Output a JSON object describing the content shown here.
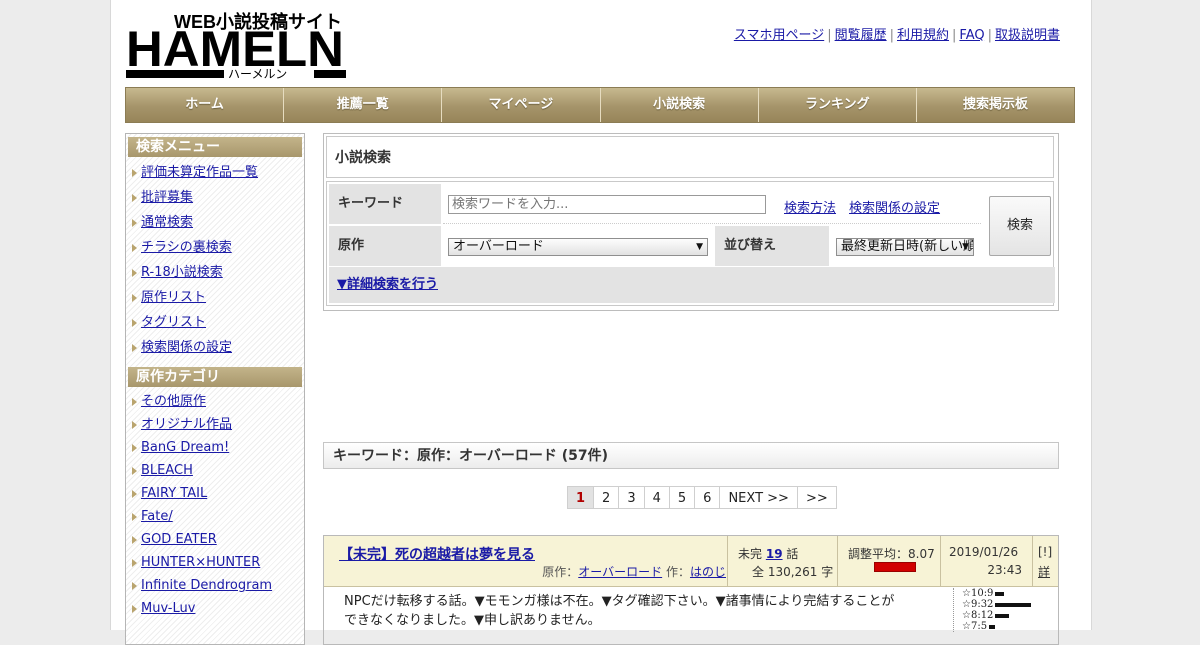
{
  "header": {
    "logo_tagline": "WEB小説投稿サイト",
    "logo_main": "HAMELN",
    "logo_kana": "ハーメルン",
    "top_links": [
      "スマホ用ページ",
      "閲覧履歴",
      "利用規約",
      "FAQ",
      "取扱説明書"
    ]
  },
  "nav": [
    "ホーム",
    "推薦一覧",
    "マイページ",
    "小説検索",
    "ランキング",
    "捜索掲示板"
  ],
  "sidebar": {
    "search_menu_title": "検索メニュー",
    "search_menu": [
      "評価未算定作品一覧",
      "批評募集",
      "通常検索",
      "チラシの裏検索",
      "R-18小説検索",
      "原作リスト",
      "タグリスト",
      "検索関係の設定"
    ],
    "category_title": "原作カテゴリ",
    "categories": [
      "その他原作",
      "オリジナル作品",
      "BanG Dream!",
      "BLEACH",
      "FAIRY TAIL",
      "Fate/",
      "GOD EATER",
      "HUNTER×HUNTER",
      "Infinite Dendrogram",
      "Muv-Luv"
    ]
  },
  "search": {
    "title": "小説検索",
    "keyword_label": "キーワード",
    "keyword_value": "",
    "keyword_placeholder": "検索ワードを入力...",
    "help_link": "検索方法",
    "settings_link": "検索関係の設定",
    "original_label": "原作",
    "original_value": "オーバーロード",
    "sort_label": "並び替え",
    "sort_value": "最終更新日時(新しい順)",
    "submit": "検索",
    "advanced": "▼詳細検索を行う"
  },
  "results": {
    "summary": "キーワード：原作：オーバーロード (57件)",
    "pages": [
      "1",
      "2",
      "3",
      "4",
      "5",
      "6",
      "NEXT >>",
      ">>"
    ],
    "active_page": "1"
  },
  "entry": {
    "title": "【未完】死の超越者は夢を見る",
    "original_prefix": "原作：",
    "original": "オーバーロード",
    "author_prefix": "作：",
    "author": "はのじ",
    "status": "未完",
    "episodes": "19",
    "episodes_unit": "話",
    "chars": "全 130,261 字",
    "rating": "調整平均：8.07",
    "rating_value": 8.07,
    "date": "2019/01/26",
    "time": "23:43",
    "flag": "[!]",
    "detail": "詳",
    "summary": "NPCだけ転移する話。▼モモンガ様は不在。▼タグ確認下さい。▼諸事情により完結することができなくなりました。▼申し訳ありません。",
    "score_rows": [
      {
        "label": "☆10:9",
        "fraction": 0.25
      },
      {
        "label": "☆9:32",
        "fraction": 1.0
      },
      {
        "label": "☆8:12",
        "fraction": 0.38
      },
      {
        "label": "☆7:5",
        "fraction": 0.16
      }
    ]
  },
  "colors": {
    "accent": "#a5946a",
    "link": "#1a1aa6",
    "rating_bar": "#d10000",
    "entry_header": "#f7f3d6"
  }
}
